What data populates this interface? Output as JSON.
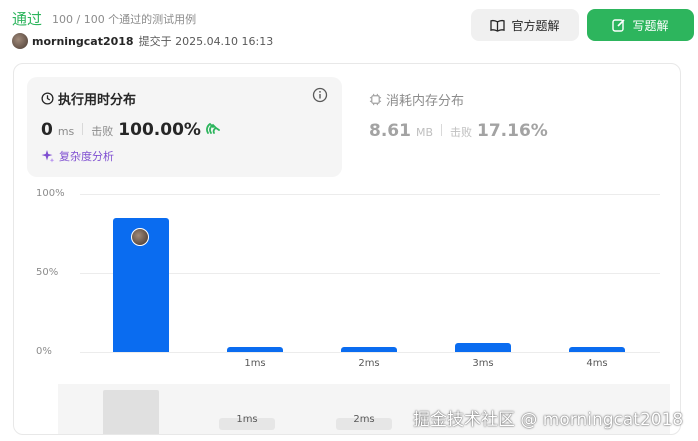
{
  "header": {
    "status": "通过",
    "passed_text": "100 / 100 个通过的测试用例",
    "username": "morningcat2018",
    "submitted_text": "提交于 2025.04.10 16:13",
    "official_solution_label": "官方题解",
    "write_solution_label": "写题解"
  },
  "runtime": {
    "title": "执行用时分布",
    "value": "0",
    "unit": "ms",
    "beat_label": "击败",
    "beat_value": "100.00%",
    "complexity_label": "复杂度分析"
  },
  "memory": {
    "title": "消耗内存分布",
    "value": "8.61",
    "unit": "MB",
    "beat_label": "击败",
    "beat_value": "17.16%"
  },
  "chart_data": {
    "type": "bar",
    "yticks": [
      "100%",
      "50%",
      "0%"
    ],
    "ylim": [
      0,
      100
    ],
    "categories": [
      "",
      "1ms",
      "2ms",
      "3ms",
      "4ms"
    ],
    "values": [
      85,
      3,
      3,
      6,
      3
    ],
    "highlighted_index": 0,
    "bar_color": "#0a6cf0"
  },
  "mini_chart": {
    "labels": [
      "1ms",
      "2ms"
    ]
  },
  "watermark": "掘金技术社区 @ morningcat2018",
  "colors": {
    "accent_green": "#2db55d",
    "bar_blue": "#0a6cf0",
    "complexity_purple": "#7f4fd1"
  }
}
